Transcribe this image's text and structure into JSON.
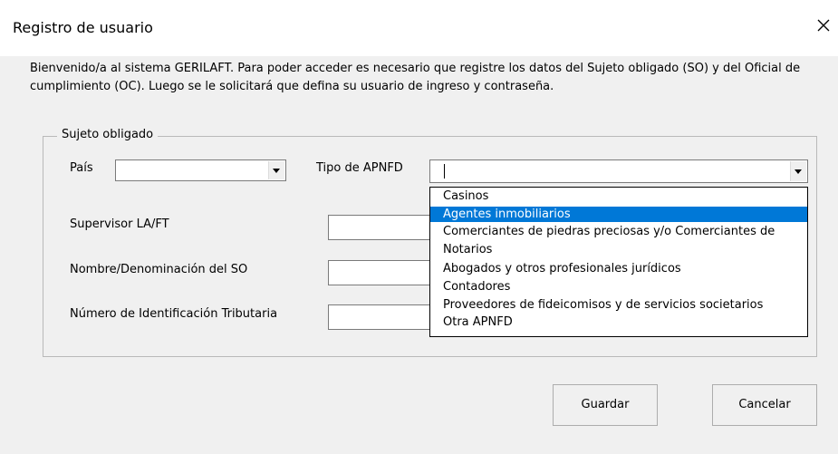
{
  "window": {
    "title": "Registro de usuario",
    "close_icon": "close-icon"
  },
  "intro": "Bienvenido/a al sistema GERILAFT. Para poder acceder es necesario que registre los datos del Sujeto obligado (SO) y del Oficial de cumplimiento (OC). Luego se le solicitará que defina su usuario de ingreso y contraseña.",
  "frame": {
    "legend": "Sujeto obligado"
  },
  "fields": {
    "pais": {
      "label": "País",
      "value": ""
    },
    "tipo": {
      "label": "Tipo de APNFD",
      "value": ""
    },
    "supervisor": {
      "label": "Supervisor LA/FT",
      "value": ""
    },
    "nombre": {
      "label": "Nombre/Denominación del SO",
      "value": ""
    },
    "nit": {
      "label": "Número de Identificación Tributaria",
      "value": ""
    }
  },
  "dropdown": {
    "options": [
      "Casinos",
      "Agentes inmobiliarios",
      "Comerciantes de piedras preciosas y/o Comerciantes de",
      "Notarios",
      "Abogados y otros profesionales jurídicos",
      "Contadores",
      "Proveedores de fideicomisos y de servicios societarios",
      "Otra APNFD"
    ],
    "selected_index": 1,
    "highlight_color": "#0078d7"
  },
  "buttons": {
    "save": "Guardar",
    "cancel": "Cancelar"
  }
}
